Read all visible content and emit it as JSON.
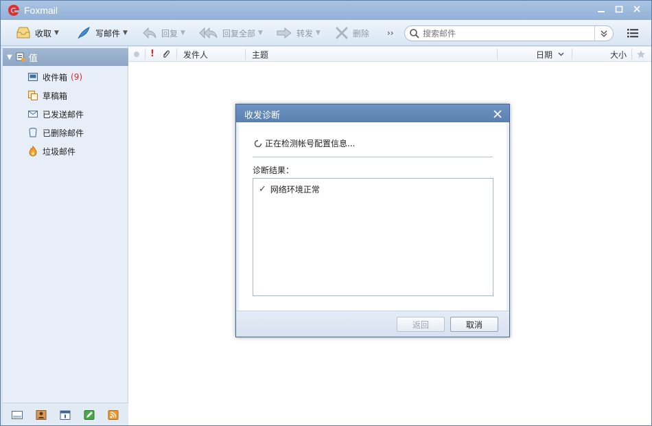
{
  "window": {
    "title": "Foxmail"
  },
  "toolbar": {
    "receive": "收取",
    "compose": "写邮件",
    "reply": "回复",
    "reply_all": "回复全部",
    "forward": "转发",
    "delete": "删除",
    "more": "››",
    "search_placeholder": "搜索邮件"
  },
  "sidebar": {
    "account": "值",
    "folders": [
      {
        "label": "收件箱",
        "badge": "(9)"
      },
      {
        "label": "草稿箱"
      },
      {
        "label": "已发送邮件"
      },
      {
        "label": "已删除邮件"
      },
      {
        "label": "垃圾邮件"
      }
    ]
  },
  "list_header": {
    "sender": "发件人",
    "subject": "主题",
    "date": "日期",
    "size": "大小"
  },
  "dialog": {
    "title": "收发诊断",
    "status": "正在检测帐号配置信息...",
    "result_label": "诊断结果：",
    "results": [
      {
        "text": "网络环境正常"
      }
    ],
    "back_button": "返回",
    "cancel_button": "取消"
  },
  "colors": {
    "title_bar": "#93b1d8",
    "accent_red": "#d62b2b",
    "dialog_title": "#5a80b1"
  }
}
